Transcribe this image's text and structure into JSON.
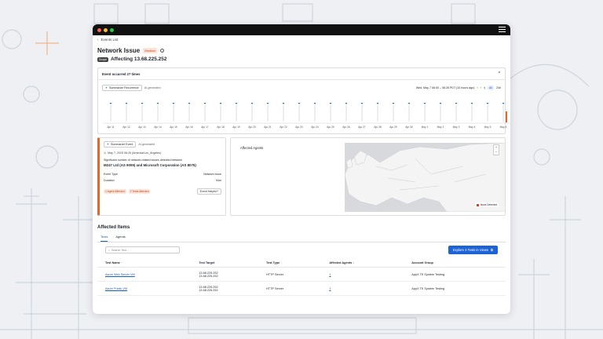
{
  "breadcrumb": {
    "label": "Events List"
  },
  "event": {
    "title": "Network Issue",
    "severity": "Medium",
    "scope_badge": "Scope",
    "affecting": "Affecting 13.68.225.252"
  },
  "occurrences": {
    "header": "Event occurred 27 times",
    "summarize_label": "Summarize Recurrence",
    "ai_label": "AI-generated",
    "range_label": "Wed, May 7 06:00 – 06:26 PDT (10 hours ago)",
    "zoom_options": [
      "All",
      "24h"
    ],
    "axis_dates": [
      "Apr 11",
      "Apr 12",
      "Apr 13",
      "Apr 14",
      "Apr 15",
      "Apr 16",
      "Apr 17",
      "Apr 18",
      "Apr 19",
      "Apr 20",
      "Apr 21",
      "Apr 22",
      "Apr 23",
      "Apr 24",
      "Apr 25",
      "Apr 26",
      "Apr 27",
      "Apr 28",
      "Apr 29",
      "Apr 30",
      "May 1",
      "May 2",
      "May 3",
      "May 4",
      "May 5",
      "May 6"
    ]
  },
  "summary_card": {
    "summarize_label": "Summarize Event",
    "ai_label": "AI-generated",
    "timestamp": "May 7, 2025 06:26 (America/Los_Angeles)",
    "intro": "Significant number of network-related issues detected between",
    "detail": "M247 Ltd (AS 9009) and Microsoft Corporation (AS 8075)",
    "event_type_label": "Event Type",
    "event_type_value": "Network Issue",
    "duration_label": "Duration",
    "duration_value": "54m",
    "agents_pill": "1 Agent Affected",
    "tests_pill": "2 Tests Affected",
    "helpful_label": "Event Helpful?"
  },
  "map_card": {
    "title": "Affected Agents",
    "legend": "Issue Detected",
    "zoom_in": "+",
    "zoom_out": "−"
  },
  "affected": {
    "heading": "Affected Items",
    "tabs": [
      "Tests",
      "Agents"
    ],
    "search_placeholder": "Search Test...",
    "explore_label": "Explore 2 Tests in Views",
    "columns": [
      "Test Name",
      "Test Target",
      "Test Type",
      "Affected Agents",
      "Account Group"
    ],
    "rows": [
      {
        "name": "Azure Web Server VM",
        "target1": "13.68.225.252",
        "target2": "13.68.225.252",
        "type": "HTTP Server",
        "agents": "1",
        "group": "AppX TE System Testing"
      },
      {
        "name": "Azure Public VM",
        "target1": "13.68.225.252",
        "target2": "13.68.225.252",
        "type": "HTTP Server",
        "agents": "1",
        "group": "AppX TE System Testing"
      }
    ]
  },
  "colors": {
    "accent": "#1d63d6",
    "severity": "#d96a33",
    "map_land": "#f4f4f5",
    "map_water": "#d7d9dd",
    "issue": "#d9412a"
  }
}
